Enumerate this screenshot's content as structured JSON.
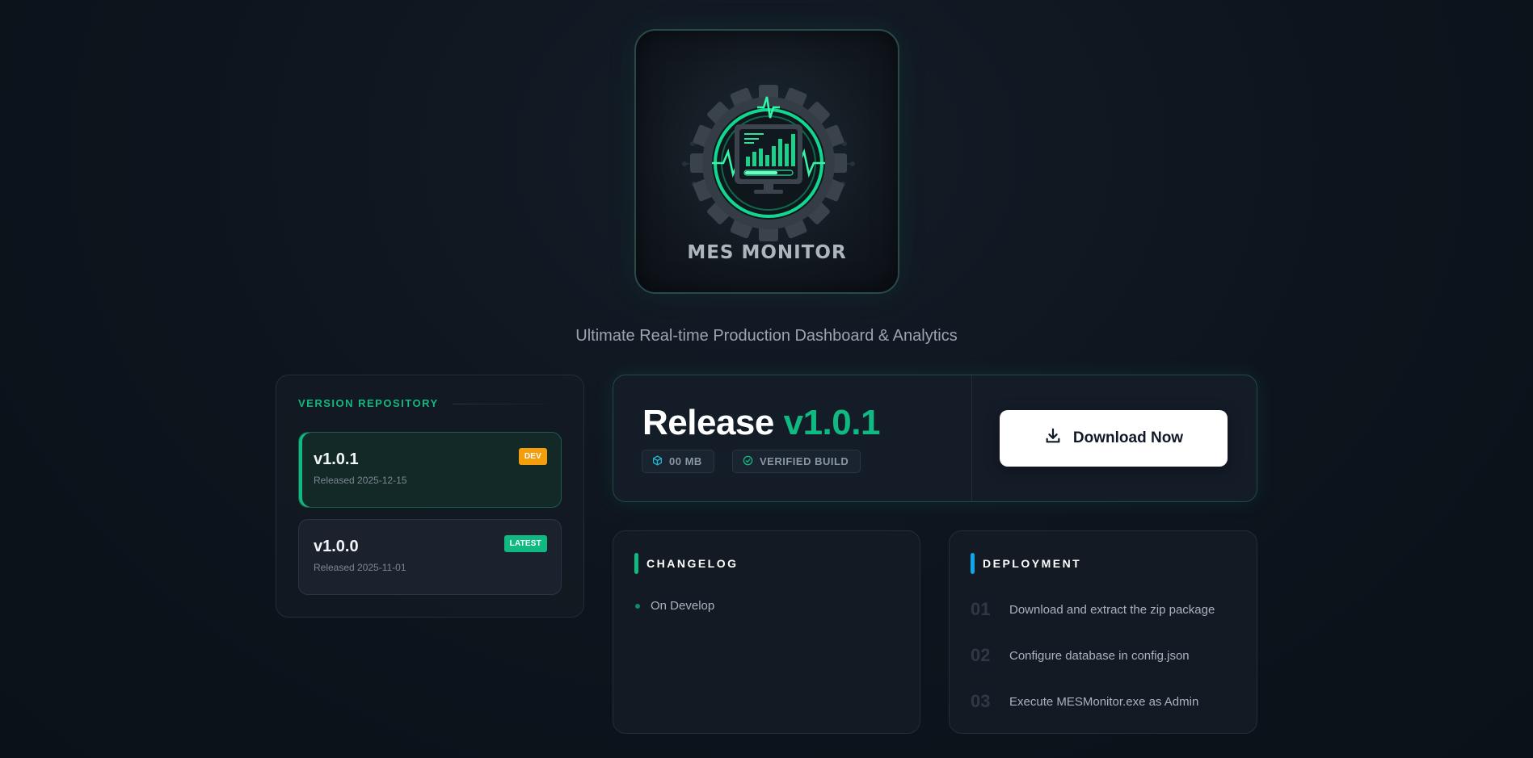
{
  "hero": {
    "logo_text": "MES MONITOR",
    "tagline": "Ultimate Real-time Production Dashboard & Analytics"
  },
  "repository": {
    "title": "VERSION REPOSITORY",
    "versions": [
      {
        "version": "v1.0.1",
        "released": "Released 2025-12-15",
        "badge": "DEV",
        "active": true
      },
      {
        "version": "v1.0.0",
        "released": "Released 2025-11-01",
        "badge": "LATEST",
        "active": false
      }
    ]
  },
  "release": {
    "prefix": "Release",
    "version": "v1.0.1",
    "size": "00 MB",
    "verified": "VERIFIED BUILD",
    "download_label": "Download Now"
  },
  "changelog": {
    "title": "CHANGELOG",
    "items": [
      "On Develop"
    ]
  },
  "deployment": {
    "title": "DEPLOYMENT",
    "steps": [
      {
        "num": "01",
        "text": "Download and extract the zip package"
      },
      {
        "num": "02",
        "text": "Configure database in config.json"
      },
      {
        "num": "03",
        "text": "Execute MESMonitor.exe as Admin"
      }
    ]
  },
  "colors": {
    "accent": "#10b981",
    "dev_badge": "#f59e0b",
    "deployment_bar": "#0ea5e9",
    "icon_cube": "#22b8cf",
    "icon_verified": "#10b981"
  },
  "icons": [
    "gear-icon",
    "monitor-icon",
    "cube-icon",
    "verified-icon",
    "download-icon"
  ]
}
